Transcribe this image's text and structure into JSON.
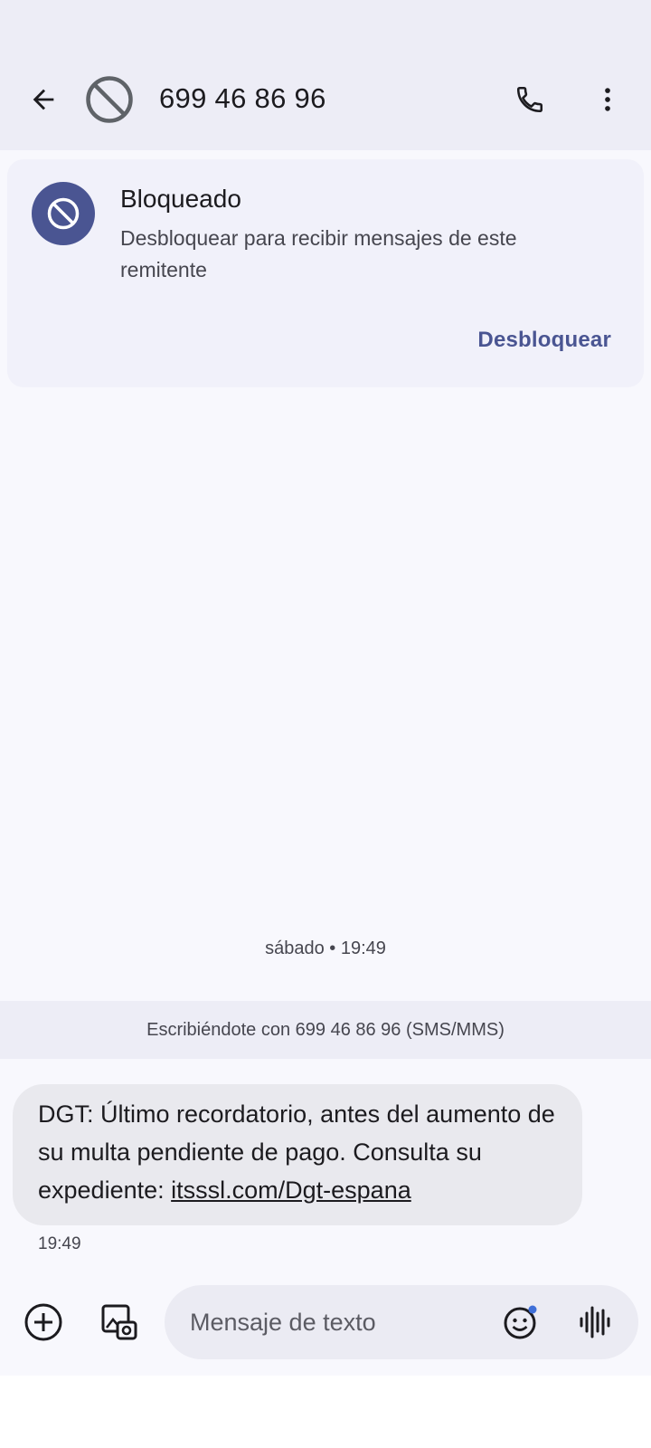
{
  "header": {
    "title": "699 46 86 96",
    "back_icon": "arrow-back-icon",
    "avatar_icon": "blocked-icon",
    "call_icon": "phone-icon",
    "more_icon": "more-vert-icon"
  },
  "blocked_banner": {
    "title": "Bloqueado",
    "description": "Desbloquear para recibir mensajes de este remitente",
    "action_label": "Desbloquear",
    "icon": "blocked-icon"
  },
  "conversation": {
    "date_label": "sábado • 19:49",
    "channel_info": "Escribiéndote con 699 46 86 96 (SMS/MMS)",
    "messages": [
      {
        "text": "DGT: Último recordatorio, antes del aumento de su multa pendiente de pago. Consulta su expediente: ",
        "link": "itsssl.com/Dgt-espana",
        "time": "19:49"
      }
    ]
  },
  "composer": {
    "placeholder": "Mensaje de texto",
    "add_icon": "add-circle-icon",
    "gallery_icon": "gallery-camera-icon",
    "emoji_icon": "emoji-icon",
    "voice_icon": "voice-waveform-icon"
  },
  "colors": {
    "accent": "#4a5592",
    "header_bg": "#ededf6",
    "bubble_bg": "#e9e9ee"
  }
}
